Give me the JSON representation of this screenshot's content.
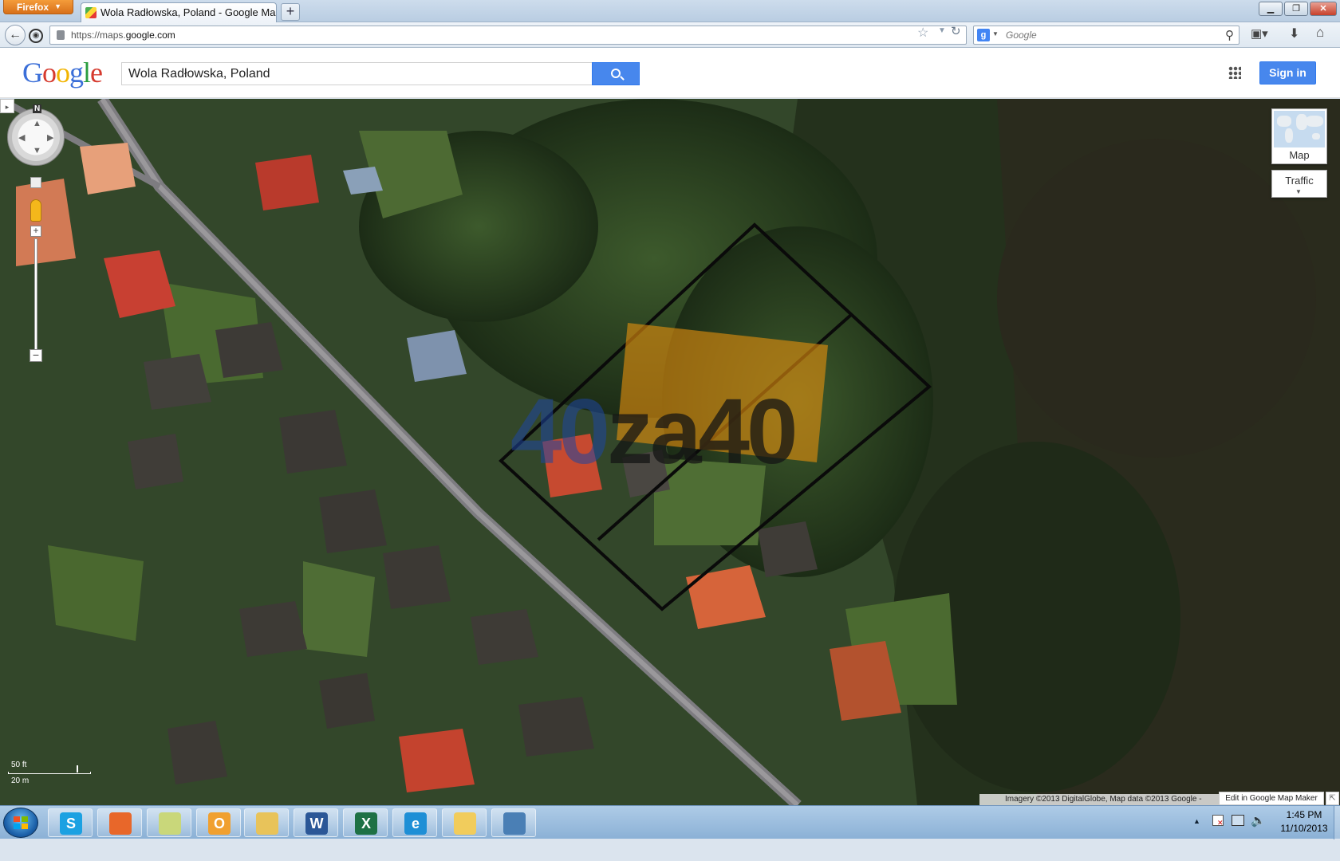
{
  "browser": {
    "menu_button": "Firefox",
    "tab_title": "Wola Radłowska, Poland - Google Maps",
    "url_prefix": "https://maps.",
    "url_host": "google.com",
    "search_placeholder": "Google"
  },
  "header": {
    "logo": [
      "G",
      "o",
      "o",
      "g",
      "l",
      "e"
    ],
    "search_value": "Wola Radłowska, Poland",
    "signin_label": "Sign in"
  },
  "map": {
    "compass_north": "N",
    "maptype_label": "Map",
    "traffic_label": "Traffic",
    "watermark": {
      "part1": "40",
      "part2": "za40"
    },
    "scale": {
      "top": "50 ft",
      "bottom": "20 m"
    },
    "attribution": "Imagery ©2013 DigitalGlobe, Map data ©2013 Google -",
    "mapmaker_label": "Edit in Google Map Maker"
  },
  "taskbar": {
    "apps": [
      {
        "name": "skype",
        "letter": "S",
        "color": "#1ba1e2"
      },
      {
        "name": "firefox",
        "letter": "",
        "color": "#e8672a"
      },
      {
        "name": "notes",
        "letter": "",
        "color": "#c9d77a"
      },
      {
        "name": "outlook",
        "letter": "O",
        "color": "#f0a030"
      },
      {
        "name": "explorer",
        "letter": "",
        "color": "#e8c35a"
      },
      {
        "name": "word",
        "letter": "W",
        "color": "#2b5797"
      },
      {
        "name": "excel",
        "letter": "X",
        "color": "#1e7145"
      },
      {
        "name": "ie",
        "letter": "e",
        "color": "#1e8fd6"
      },
      {
        "name": "folder",
        "letter": "",
        "color": "#f1cc5c"
      },
      {
        "name": "photos",
        "letter": "",
        "color": "#4a7fb5"
      }
    ],
    "clock_time": "1:45 PM",
    "clock_date": "11/10/2013"
  }
}
